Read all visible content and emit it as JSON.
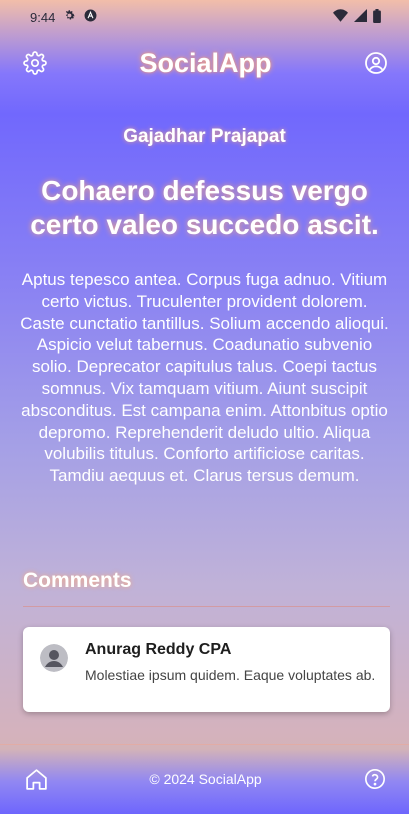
{
  "status_bar": {
    "time": "9:44",
    "left_icons": [
      "gear-icon",
      "a-icon"
    ],
    "right_icons": [
      "wifi-icon",
      "signal-icon",
      "battery-icon"
    ]
  },
  "header": {
    "title": "SocialApp",
    "left_icon": "gear-icon",
    "right_icon": "account-icon"
  },
  "post": {
    "author": "Gajadhar Prajapat",
    "title": "Cohaero defessus vergo certo valeo succedo ascit.",
    "body": "Aptus tepesco antea. Corpus fuga adnuo. Vitium certo victus. Truculenter provident dolorem. Caste cunctatio tantillus. Solium accendo alioqui. Aspicio velut tabernus. Coadunatio subvenio solio. Deprecator capitulus talus. Coepi tactus somnus. Vix tamquam vitium. Aiunt suscipit absconditus. Est campana enim. Attonbitus optio depromo. Reprehenderit deludo ultio. Aliqua volubilis titulus. Conforto artificiose caritas. Tamdiu aequus et. Clarus tersus demum."
  },
  "comments": {
    "heading": "Comments",
    "items": [
      {
        "author": "Anurag Reddy CPA",
        "text": "Molestiae ipsum quidem. Eaque voluptates ab."
      }
    ]
  },
  "footer": {
    "copyright": "© 2024 SocialApp",
    "left_icon": "home-icon",
    "right_icon": "help-icon"
  },
  "colors": {
    "accent": "#6e66fd",
    "glow": "#ffaa78"
  }
}
